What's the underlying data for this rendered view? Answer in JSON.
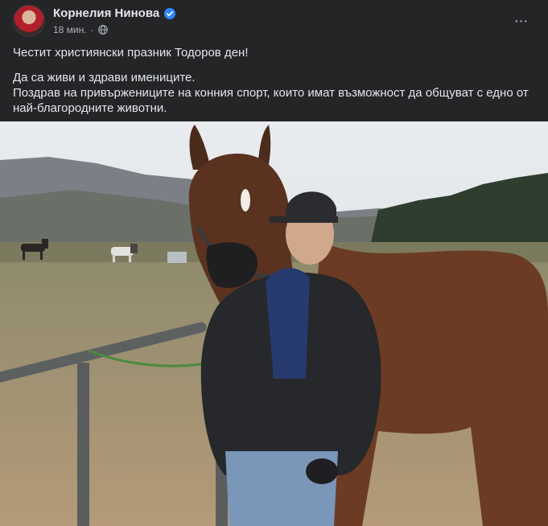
{
  "author": {
    "name": "Корнелия Нинова",
    "verified": true
  },
  "meta": {
    "time": "18 мин.",
    "separator": "·",
    "audience_icon": "globe-icon"
  },
  "menu": {
    "icon": "more-horizontal-icon",
    "glyph": "···"
  },
  "post": {
    "line1": "Честит християнски празник Тодоров ден!",
    "line2": "Да са живи и здрави имениците.",
    "line3": "Поздрав на  привържениците на конния спорт, които имат възможност да общуват с едно от най-благородните животни."
  },
  "colors": {
    "background": "#242526",
    "text_primary": "#e4e6eb",
    "text_secondary": "#b0b3b8",
    "verified_badge": "#2d88ff"
  }
}
